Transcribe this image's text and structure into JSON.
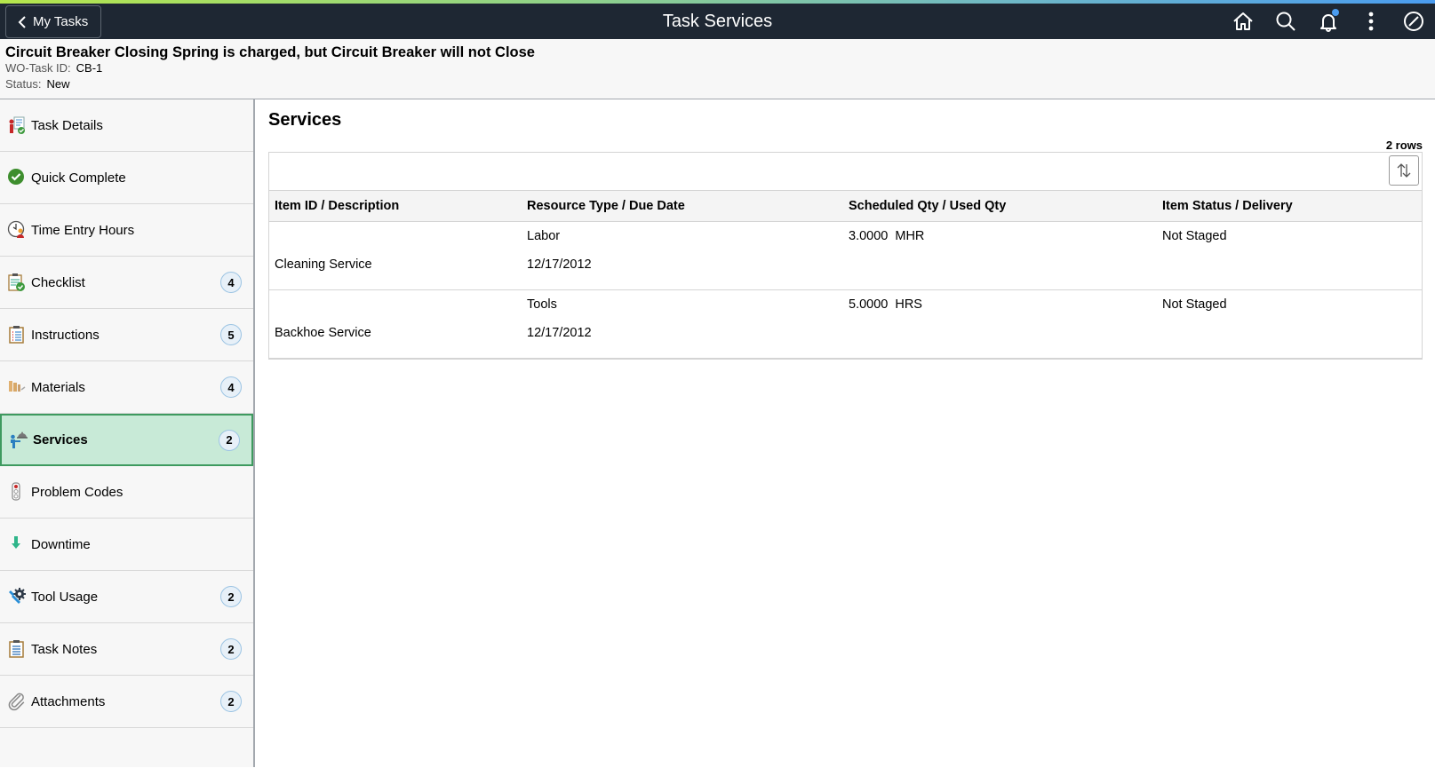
{
  "header": {
    "title": "Task Services",
    "back_label": "My Tasks",
    "icons": [
      "home-icon",
      "search-icon",
      "notifications-icon",
      "more-options-icon",
      "navigator-icon"
    ],
    "accent_gradient": [
      "#b5e64c",
      "#4a9cf0"
    ],
    "bar_color": "#1e2733"
  },
  "task": {
    "title": "Circuit Breaker Closing Spring is charged, but Circuit Breaker will not Close",
    "id_label": "WO-Task ID:",
    "id_value": "CB-1",
    "status_label": "Status:",
    "status_value": "New"
  },
  "sidebar": {
    "items": [
      {
        "label": "Task Details",
        "icon": "task-details-icon",
        "badge": null
      },
      {
        "label": "Quick Complete",
        "icon": "check-circle-icon",
        "badge": null
      },
      {
        "label": "Time Entry Hours",
        "icon": "clock-person-icon",
        "badge": null
      },
      {
        "label": "Checklist",
        "icon": "checklist-icon",
        "badge": "4"
      },
      {
        "label": "Instructions",
        "icon": "clipboard-list-icon",
        "badge": "5"
      },
      {
        "label": "Materials",
        "icon": "materials-icon",
        "badge": "4"
      },
      {
        "label": "Services",
        "icon": "waiter-service-icon",
        "badge": "2",
        "active": true
      },
      {
        "label": "Problem Codes",
        "icon": "traffic-light-icon",
        "badge": null
      },
      {
        "label": "Downtime",
        "icon": "down-arrow-icon",
        "badge": null
      },
      {
        "label": "Tool Usage",
        "icon": "wrench-gear-icon",
        "badge": "2"
      },
      {
        "label": "Task Notes",
        "icon": "notes-clipboard-icon",
        "badge": "2"
      },
      {
        "label": "Attachments",
        "icon": "paperclip-icon",
        "badge": "2"
      }
    ],
    "active_color": "#c8ead7",
    "active_border": "#3e9a5f"
  },
  "main": {
    "title": "Services",
    "row_count": "2 rows",
    "columns": [
      "Item ID / Description",
      "Resource Type / Due Date",
      "Scheduled Qty / Used Qty",
      "Item Status / Delivery"
    ],
    "rows": [
      {
        "item_id": "",
        "description": "Cleaning Service",
        "resource_type": "Labor",
        "due_date": "12/17/2012",
        "qty": "3.0000",
        "unit": "MHR",
        "status": "Not Staged"
      },
      {
        "item_id": "",
        "description": "Backhoe Service",
        "resource_type": "Tools",
        "due_date": "12/17/2012",
        "qty": "5.0000",
        "unit": "HRS",
        "status": "Not Staged"
      }
    ]
  }
}
